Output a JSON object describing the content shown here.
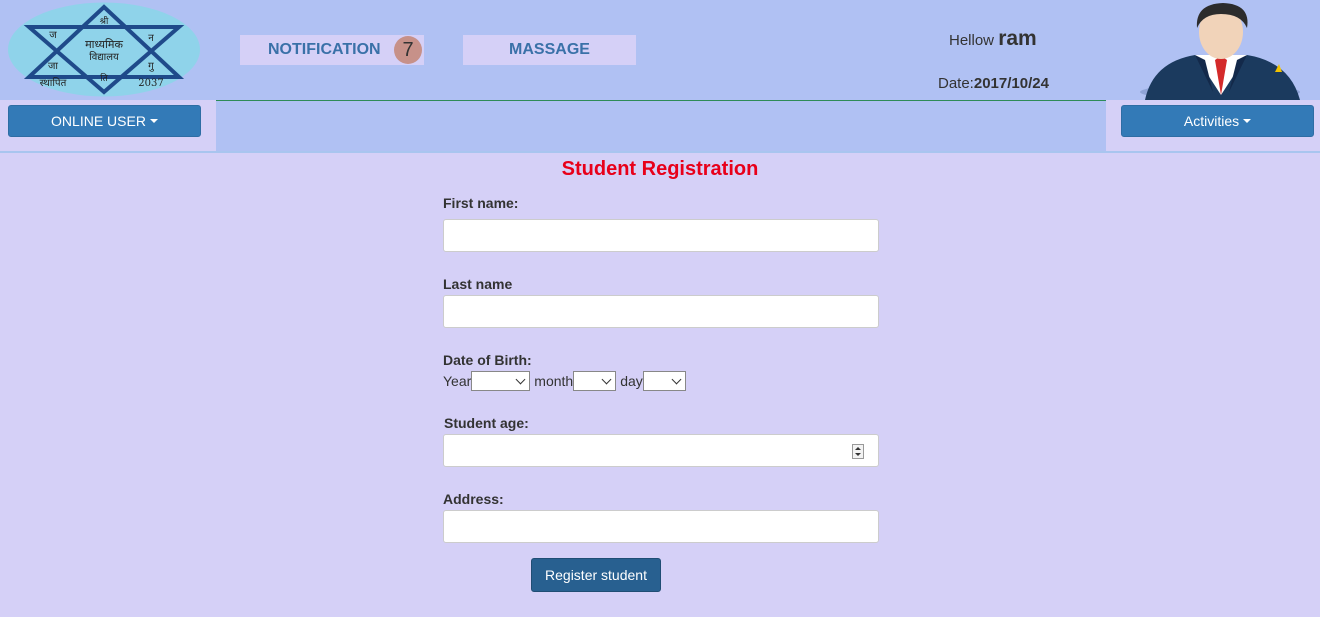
{
  "header": {
    "logo": {
      "top": "श्री",
      "left_top": "ज",
      "right_top": "न",
      "center_line1": "माध्यमिक",
      "center_line2": "विद्यालय",
      "left_mid": "जा",
      "right_mid": "गु",
      "bottom_mid": "ति",
      "est_label": "स्थापित",
      "est_year": "2037"
    },
    "notification_label": "NOTIFICATION",
    "notification_count": "7",
    "message_label": "MASSAGE",
    "greeting": "Hellow",
    "username": "ram",
    "date_label": "Date:",
    "date_value": "2017/10/24",
    "avatar_icon": "businessman-avatar-icon"
  },
  "nav": {
    "online_user_label": "ONLINE USER",
    "activities_label": "Activities"
  },
  "form": {
    "title": "Student Registration",
    "first_name_label": "First name:",
    "last_name_label": "Last name",
    "dob_label": "Date of Birth:",
    "year_label": "Year",
    "month_label": "month",
    "day_label": "day",
    "age_label": "Student age:",
    "address_label": "Address:",
    "submit_label": "Register student"
  },
  "colors": {
    "header_bg": "#b0c1f3",
    "page_bg": "#d5d0f7",
    "primary_button": "#337ab7",
    "title_red": "#e8001a"
  }
}
